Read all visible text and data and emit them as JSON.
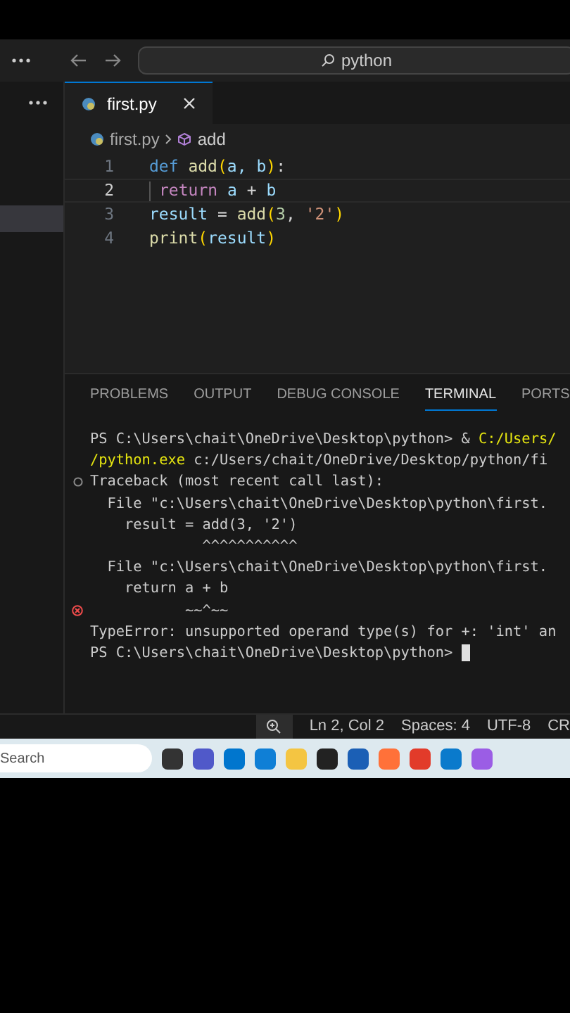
{
  "title_bar": {
    "search": "python"
  },
  "tabs": [
    {
      "label": "first.py",
      "selected": true
    }
  ],
  "breadcrumb": {
    "file": "first.py",
    "symbol": "add"
  },
  "code": [
    {
      "number": "1",
      "current": false,
      "tokens": [
        {
          "kind": "keyword",
          "text": "def "
        },
        {
          "kind": "func",
          "text": "add"
        },
        {
          "kind": "paren",
          "text": "("
        },
        {
          "kind": "var",
          "text": "a, b"
        },
        {
          "kind": "paren",
          "text": ")"
        },
        {
          "kind": "plain",
          "text": ":"
        }
      ]
    },
    {
      "number": "2",
      "current": true,
      "tokens": [
        {
          "kind": "indent"
        },
        {
          "kind": "control",
          "text": "return "
        },
        {
          "kind": "var",
          "text": "a "
        },
        {
          "kind": "plain",
          "text": "+ "
        },
        {
          "kind": "var",
          "text": "b"
        }
      ]
    },
    {
      "number": "3",
      "current": false,
      "tokens": [
        {
          "kind": "var",
          "text": "result "
        },
        {
          "kind": "plain",
          "text": "= "
        },
        {
          "kind": "func",
          "text": "add"
        },
        {
          "kind": "paren",
          "text": "("
        },
        {
          "kind": "number",
          "text": "3"
        },
        {
          "kind": "plain",
          "text": ", "
        },
        {
          "kind": "string",
          "text": "'2'"
        },
        {
          "kind": "paren",
          "text": ")"
        }
      ]
    },
    {
      "number": "4",
      "current": false,
      "tokens": [
        {
          "kind": "func",
          "text": "print"
        },
        {
          "kind": "paren",
          "text": "("
        },
        {
          "kind": "var",
          "text": "result"
        },
        {
          "kind": "paren",
          "text": ")"
        }
      ]
    }
  ],
  "panel_tabs": [
    {
      "label": "PROBLEMS",
      "selected": false
    },
    {
      "label": "OUTPUT",
      "selected": false
    },
    {
      "label": "DEBUG CONSOLE",
      "selected": false
    },
    {
      "label": "TERMINAL",
      "selected": true
    },
    {
      "label": "PORTS",
      "selected": false
    }
  ],
  "terminal": [
    {
      "kind": "plain",
      "segments": [
        {
          "kind": "plain",
          "text": "PS C:\\Users\\chait\\OneDrive\\Desktop\\python> & "
        },
        {
          "kind": "path",
          "text": "C:/Users/"
        }
      ]
    },
    {
      "kind": "plain",
      "segments": [
        {
          "kind": "path",
          "text": "/python.exe"
        },
        {
          "kind": "plain",
          "text": " c:/Users/chait/OneDrive/Desktop/python/fi"
        }
      ]
    },
    {
      "kind": "circle",
      "segments": [
        {
          "kind": "plain",
          "text": "Traceback (most recent call last):"
        }
      ]
    },
    {
      "kind": "plain",
      "segments": [
        {
          "kind": "plain",
          "text": "  File \"c:\\Users\\chait\\OneDrive\\Desktop\\python\\first."
        }
      ]
    },
    {
      "kind": "plain",
      "segments": [
        {
          "kind": "plain",
          "text": "    result = add(3, '2')"
        }
      ]
    },
    {
      "kind": "plain",
      "segments": [
        {
          "kind": "plain",
          "text": "             ^^^^^^^^^^^"
        }
      ]
    },
    {
      "kind": "plain",
      "segments": [
        {
          "kind": "plain",
          "text": "  File \"c:\\Users\\chait\\OneDrive\\Desktop\\python\\first."
        }
      ]
    },
    {
      "kind": "plain",
      "segments": [
        {
          "kind": "plain",
          "text": "    return a + b"
        }
      ]
    },
    {
      "kind": "error",
      "segments": [
        {
          "kind": "plain",
          "text": "           ~~^~~"
        }
      ]
    },
    {
      "kind": "plain",
      "segments": [
        {
          "kind": "plain",
          "text": "TypeError: unsupported operand type(s) for +: 'int' an"
        }
      ]
    },
    {
      "kind": "plain",
      "segments": [
        {
          "kind": "plain",
          "text": "PS C:\\Users\\chait\\OneDrive\\Desktop\\python> "
        },
        {
          "kind": "cursor"
        }
      ]
    }
  ],
  "status_bar": [
    "Ln 2, Col 2",
    "Spaces: 4",
    "UTF-8",
    "CR"
  ],
  "taskbar": {
    "search": "Search"
  }
}
